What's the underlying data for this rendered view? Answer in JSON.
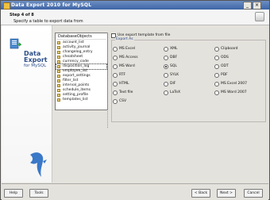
{
  "window": {
    "title": "Data Export 2010 for MySQL"
  },
  "header": {
    "step": "Step 4 of 8",
    "description": "Specify a table to export data from"
  },
  "sidebar": {
    "product_line1": "Data",
    "product_line2": "Export",
    "product_line3": "for MySQL"
  },
  "table_list": {
    "header": "DatabaseObjects",
    "items": [
      {
        "label": "account_list"
      },
      {
        "label": "activity_journal"
      },
      {
        "label": "changelog_entry"
      },
      {
        "label": "cheatsheet"
      },
      {
        "label": "currency_code"
      },
      {
        "label": "disposition_log",
        "selected": true
      },
      {
        "label": "employee_list"
      },
      {
        "label": "export_settings"
      },
      {
        "label": "filter_list"
      },
      {
        "label": "interval_points"
      },
      {
        "label": "schedule_items"
      },
      {
        "label": "setting_profile"
      },
      {
        "label": "templates_list"
      }
    ]
  },
  "options": {
    "checkbox_label": "Use export template from file",
    "group_label": "Export As",
    "formats": [
      {
        "label": "MS Excel"
      },
      {
        "label": "MS Access"
      },
      {
        "label": "MS Word"
      },
      {
        "label": "RTF"
      },
      {
        "label": "HTML"
      },
      {
        "label": "Text file"
      },
      {
        "label": "CSV"
      },
      {
        "label": "XML"
      },
      {
        "label": "DBF"
      },
      {
        "label": "SQL",
        "checked": true
      },
      {
        "label": "SYLK"
      },
      {
        "label": "DIF"
      },
      {
        "label": "LaTeX"
      },
      {
        "label": "Clipboard"
      },
      {
        "label": "ODS"
      },
      {
        "label": "ODT"
      },
      {
        "label": "PDF"
      },
      {
        "label": "MS Excel 2007"
      },
      {
        "label": "MS Word 2007"
      }
    ]
  },
  "buttons": {
    "help": "Help",
    "tools": "Tools",
    "back": "< Back",
    "next": "Next >",
    "cancel": "Cancel"
  }
}
